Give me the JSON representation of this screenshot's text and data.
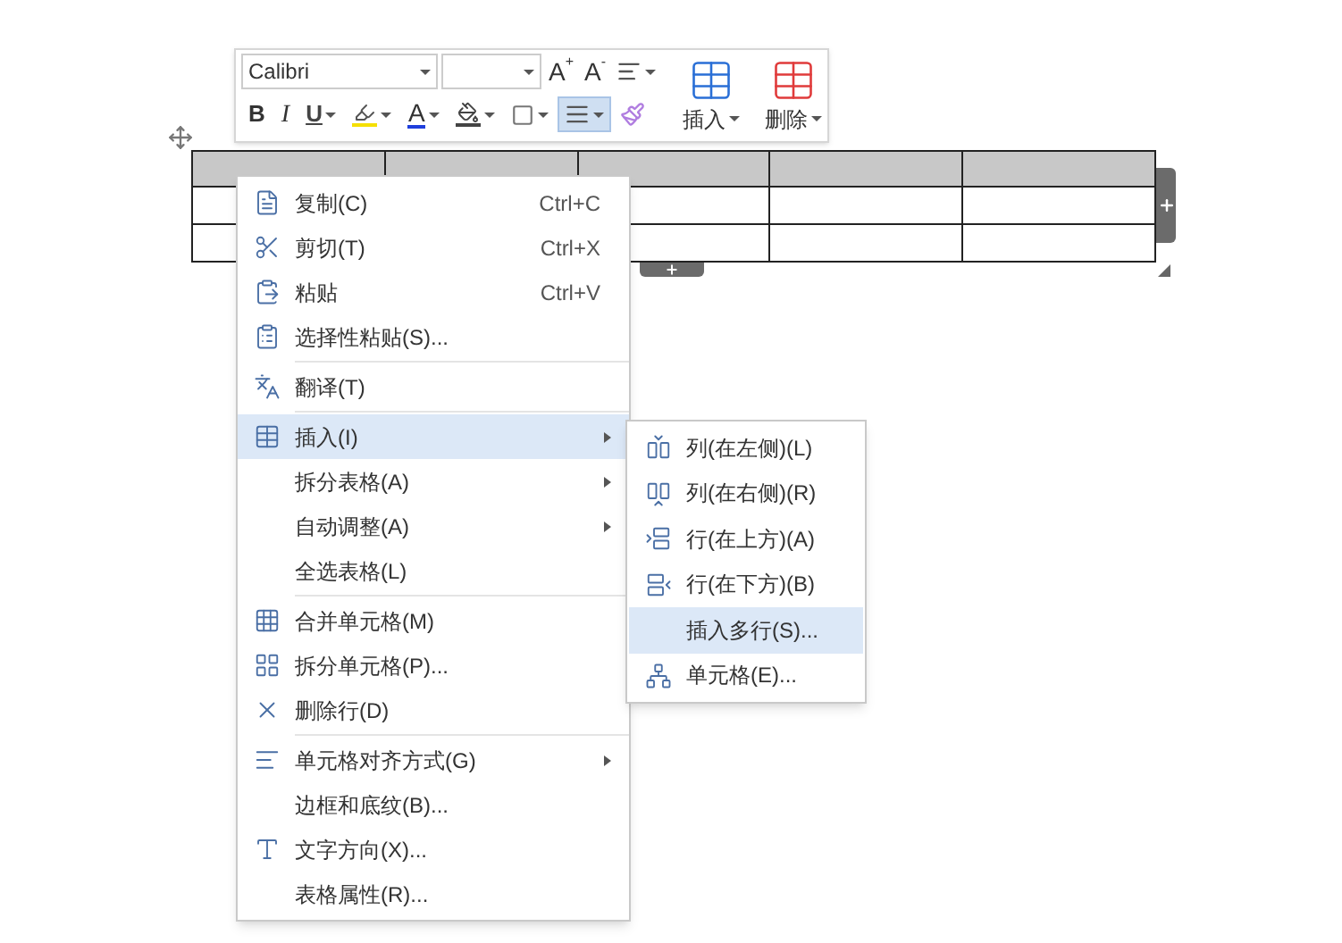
{
  "toolbar": {
    "font": "Calibri",
    "size_buttons": [
      {
        "label": "A",
        "mark": "+"
      },
      {
        "label": "A",
        "mark": "-"
      }
    ],
    "format_buttons": [
      {
        "kind": "bold",
        "label": "B",
        "selected": false
      },
      {
        "kind": "italic",
        "label": "I",
        "selected": false
      },
      {
        "kind": "underline",
        "label": "U",
        "selected": false
      },
      {
        "kind": "highlight",
        "selected": false
      },
      {
        "kind": "font_color",
        "label": "A",
        "selected": false
      },
      {
        "kind": "shading",
        "selected": false
      },
      {
        "kind": "borders",
        "selected": false
      },
      {
        "kind": "align",
        "selected": true
      },
      {
        "kind": "painter",
        "selected": false
      }
    ],
    "big_buttons": [
      {
        "kind": "insert",
        "label": "插入"
      },
      {
        "kind": "delete",
        "label": "删除"
      }
    ]
  },
  "table": {
    "rows": [
      {
        "shaded": true
      },
      {
        "shaded": false
      },
      {
        "shaded": false
      }
    ]
  },
  "menu": {
    "groups": [
      {
        "items": [
          {
            "label": "复制(C)",
            "shortcut": "Ctrl+C",
            "submenu": false,
            "selected": false
          },
          {
            "label": "剪切(T)",
            "shortcut": "Ctrl+X",
            "submenu": false,
            "selected": false
          },
          {
            "label": "粘贴",
            "shortcut": "Ctrl+V",
            "submenu": false,
            "selected": false
          },
          {
            "label": "选择性粘贴(S)...",
            "submenu": false,
            "selected": false
          }
        ]
      },
      {
        "items": [
          {
            "label": "翻译(T)",
            "submenu": false,
            "selected": false
          }
        ]
      },
      {
        "items": [
          {
            "label": "插入(I)",
            "submenu": true,
            "selected": true
          },
          {
            "label": "拆分表格(A)",
            "submenu": true,
            "selected": false
          },
          {
            "label": "自动调整(A)",
            "submenu": true,
            "selected": false
          },
          {
            "label": "全选表格(L)",
            "submenu": false,
            "selected": false
          }
        ]
      },
      {
        "items": [
          {
            "label": "合并单元格(M)",
            "submenu": false,
            "selected": false
          },
          {
            "label": "拆分单元格(P)...",
            "submenu": false,
            "selected": false
          },
          {
            "label": "删除行(D)",
            "submenu": false,
            "selected": false
          }
        ]
      },
      {
        "items": [
          {
            "label": "单元格对齐方式(G)",
            "submenu": true,
            "selected": false
          },
          {
            "label": "边框和底纹(B)...",
            "submenu": false,
            "selected": false
          },
          {
            "label": "文字方向(X)...",
            "submenu": false,
            "selected": false
          },
          {
            "label": "表格属性(R)...",
            "submenu": false,
            "selected": false
          }
        ]
      }
    ]
  },
  "submenu": {
    "items": [
      {
        "label": "列(在左侧)(L)",
        "selected": false
      },
      {
        "label": "列(在右侧)(R)",
        "selected": false
      },
      {
        "label": "行(在上方)(A)",
        "selected": false
      },
      {
        "label": "行(在下方)(B)",
        "selected": false
      },
      {
        "label": "插入多行(S)...",
        "selected": true
      },
      {
        "label": "单元格(E)...",
        "selected": false
      }
    ]
  }
}
